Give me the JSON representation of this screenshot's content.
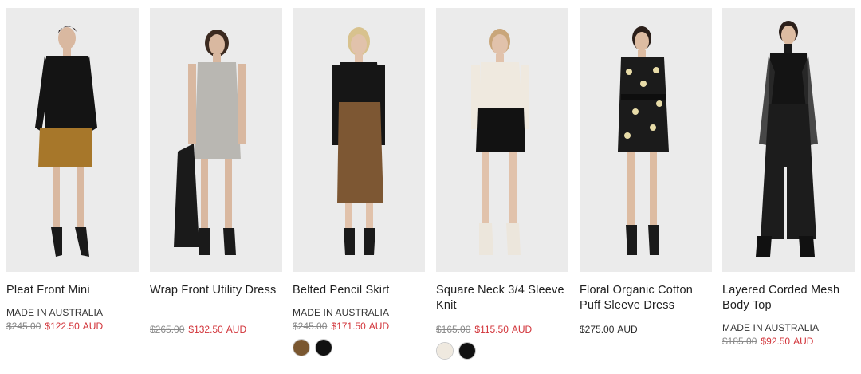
{
  "products": [
    {
      "name": "Pleat Front Mini",
      "origin": "MADE IN AUSTRALIA",
      "was_price": "$245.00",
      "price": "$122.50",
      "currency": "AUD",
      "on_sale": true,
      "swatches": []
    },
    {
      "name": "Wrap Front Utility Dress",
      "origin": "",
      "was_price": "$265.00",
      "price": "$132.50",
      "currency": "AUD",
      "on_sale": true,
      "swatches": []
    },
    {
      "name": "Belted Pencil Skirt",
      "origin": "MADE IN AUSTRALIA",
      "was_price": "$245.00",
      "price": "$171.50",
      "currency": "AUD",
      "on_sale": true,
      "swatches": [
        "#7a5730",
        "#111111"
      ]
    },
    {
      "name": "Square Neck 3/4 Sleeve Knit",
      "origin": "",
      "was_price": "$165.00",
      "price": "$115.50",
      "currency": "AUD",
      "on_sale": true,
      "swatches": [
        "#efe9df",
        "#111111"
      ]
    },
    {
      "name": "Floral Organic Cotton Puff Sleeve Dress",
      "origin": "",
      "was_price": "",
      "price": "$275.00",
      "currency": "AUD",
      "on_sale": false,
      "swatches": []
    },
    {
      "name": "Layered Corded Mesh Body Top",
      "origin": "MADE IN AUSTRALIA",
      "was_price": "$185.00",
      "price": "$92.50",
      "currency": "AUD",
      "on_sale": true,
      "swatches": []
    }
  ],
  "colors": {
    "sale_price": "#d2343a",
    "was_price": "#8a8a8a",
    "photo_bg": "#ebebeb"
  }
}
